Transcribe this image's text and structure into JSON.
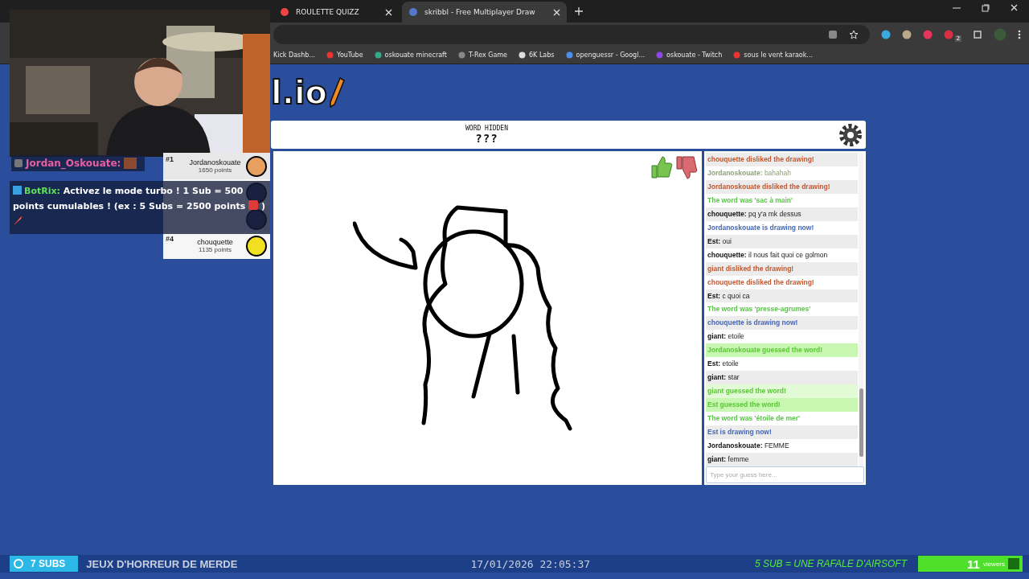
{
  "browser": {
    "tabs": [
      {
        "title": "ROULETTE QUIZZ",
        "selected": false
      },
      {
        "title": "skribbl - Free Multiplayer Draw",
        "selected": true
      }
    ],
    "bookmarks": [
      "Kick Dashb...",
      "YouTube",
      "oskouate minecraft",
      "T-Rex Game",
      "6K Labs",
      "openguessr - Googl...",
      "oskouate - Twitch",
      "sous le vent karaok..."
    ],
    "extension_badge": "2"
  },
  "logo": "l.io",
  "game": {
    "word_label": "WORD HIDDEN",
    "word": "???",
    "guess_placeholder": "Type your guess here...",
    "messages": [
      {
        "kind": "dislike",
        "text": "chouquette disliked the drawing!"
      },
      {
        "kind": "chat",
        "name": "Jordanoskouate:",
        "text": "bahahah",
        "faded": true
      },
      {
        "kind": "dislike",
        "text": "Jordanoskouate disliked the drawing!"
      },
      {
        "kind": "word",
        "text": "The word was 'sac à main'"
      },
      {
        "kind": "chat",
        "name": "chouquette:",
        "text": "pq y'a mk dessus",
        "faded": false
      },
      {
        "kind": "drawing",
        "text": "Jordanoskouate is drawing now!"
      },
      {
        "kind": "chat",
        "name": "Est:",
        "text": "oui",
        "faded": false
      },
      {
        "kind": "chat",
        "name": "chouquette:",
        "text": "il nous fait quoi ce golmon",
        "faded": false
      },
      {
        "kind": "dislike",
        "text": "giant disliked the drawing!"
      },
      {
        "kind": "dislike",
        "text": "chouquette disliked the drawing!"
      },
      {
        "kind": "chat",
        "name": "Est:",
        "text": "c quoi ca",
        "faded": false
      },
      {
        "kind": "word",
        "text": "The word was 'presse-agrumes'"
      },
      {
        "kind": "drawing",
        "text": "chouquette is drawing now!"
      },
      {
        "kind": "chat",
        "name": "giant:",
        "text": "etoile",
        "faded": false
      },
      {
        "kind": "guessed",
        "text": "Jordanoskouate guessed the word!"
      },
      {
        "kind": "chat",
        "name": "Est:",
        "text": "etoile",
        "faded": false
      },
      {
        "kind": "chat",
        "name": "giant:",
        "text": "star",
        "faded": false
      },
      {
        "kind": "guessed",
        "text": "giant guessed the word!"
      },
      {
        "kind": "guessed",
        "text": "Est guessed the word!"
      },
      {
        "kind": "word",
        "text": "The word was 'étoile de mer'"
      },
      {
        "kind": "drawing",
        "text": "Est is drawing now!"
      },
      {
        "kind": "chat",
        "name": "Jordanoskouate:",
        "text": "FEMME",
        "faded": false
      },
      {
        "kind": "chat",
        "name": "giant:",
        "text": "femme",
        "faded": false
      }
    ],
    "players": [
      {
        "rank": "#1",
        "name": "Jordanoskouate",
        "points": "1650 points",
        "color": "#e8a060"
      },
      {
        "kind": "covered"
      },
      {
        "kind": "covered"
      },
      {
        "rank": "#4",
        "name": "chouquette",
        "points": "1135 points",
        "color": "#f0e020"
      }
    ]
  },
  "stream": {
    "chat": [
      {
        "user": "Jordan_Oskouate:",
        "kind": "emote"
      },
      {
        "user": "BotRix:",
        "kind": "bot",
        "text": "Activez le mode turbo ! 1 Sub = 500 points cumulables ! (ex : 5 Subs = 2500 points",
        "tail": ")"
      }
    ],
    "subs": "7 SUBS",
    "category": "JEUX D'HORREUR DE MERDE",
    "datetime": "17/01/2026 22:05:37",
    "goal": "5 SUB = UNE RAFALE D'AIRSOFT",
    "viewer_count": "11",
    "viewer_label": "viewers"
  }
}
